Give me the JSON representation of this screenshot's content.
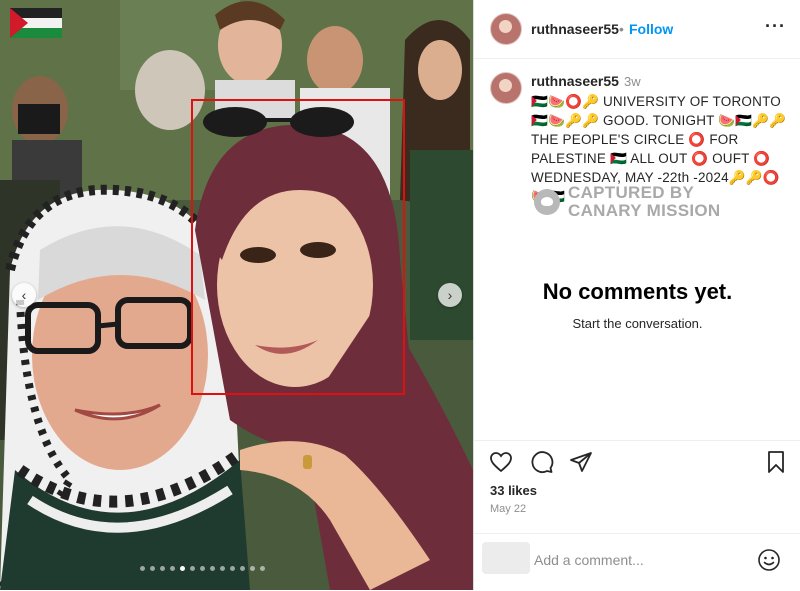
{
  "post": {
    "username": "ruthnaseer55",
    "follow_label": "Follow",
    "separator": "•",
    "more_label": "···",
    "time_ago": "3w",
    "caption": "🇵🇸🍉⭕🔑 UNIVERSITY OF TORONTO 🇵🇸🍉🔑🔑 GOOD. TONIGHT 🍉🇵🇸🔑🔑 THE PEOPLE'S CIRCLE ⭕ FOR PALESTINE 🇵🇸 ALL OUT ⭕ OUFT ⭕ WEDNESDAY, MAY -22th -2024🔑🔑⭕🍉🇵🇸",
    "watermark_line1": "CAPTURED BY",
    "watermark_line2": "CANARY MISSION",
    "no_comments": "No comments yet.",
    "start_conversation": "Start the conversation.",
    "likes": "33 likes",
    "date": "May 22",
    "comment_placeholder": "Add a comment...",
    "carousel": {
      "count": 13,
      "active_index": 4
    }
  },
  "colors": {
    "accent": "#0095f6",
    "highlight": "#e01010",
    "text": "#262626",
    "muted": "#8e8e8e"
  },
  "icons": [
    "chevron-left-icon",
    "chevron-right-icon",
    "more-icon",
    "heart-icon",
    "comment-icon",
    "share-icon",
    "bookmark-icon",
    "emoji-icon",
    "canary-mission-logo-icon"
  ]
}
